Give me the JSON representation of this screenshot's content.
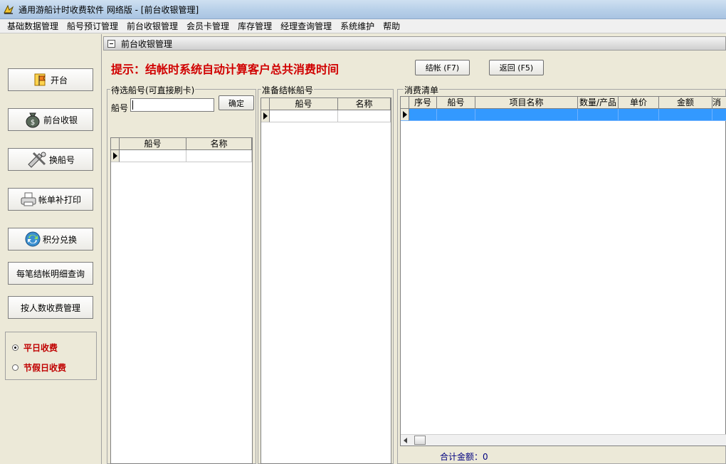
{
  "window": {
    "title": "通用游船计时收费软件  网络版 - [前台收银管理]"
  },
  "menu": [
    "基础数据管理",
    "船号预订管理",
    "前台收银管理",
    "会员卡管理",
    "库存管理",
    "经理查询管理",
    "系统维护",
    "帮助"
  ],
  "left": {
    "buttons": [
      {
        "label": "开台",
        "icon": "flag-icon"
      },
      {
        "label": "前台收银",
        "icon": "money-bag-icon"
      },
      {
        "label": "换船号",
        "icon": "tools-icon"
      },
      {
        "label": "帐单补打印",
        "icon": "printer-icon"
      },
      {
        "label": "积分兑换",
        "icon": "exchange-icon"
      },
      {
        "label": "每笔结帐明细查询"
      },
      {
        "label": "按人数收费管理"
      }
    ],
    "radios": [
      {
        "label": "平日收费",
        "checked": true
      },
      {
        "label": "节假日收费",
        "checked": false
      }
    ]
  },
  "main": {
    "header": "前台收银管理",
    "hint": "提示：结帐时系统自动计算客户总共消费时间",
    "checkout_button": "结帐 (F7)",
    "back_button": "返回 (F5)",
    "pending": {
      "title": "待选船号(可直接刷卡)",
      "boat_label": "船号",
      "confirm_button": "确定",
      "columns": [
        "船号",
        "名称"
      ]
    },
    "ready": {
      "title": "准备结帐船号",
      "columns": [
        "船号",
        "名称"
      ]
    },
    "consume": {
      "title": "消费清单",
      "columns": [
        "序号",
        "船号",
        "项目名称",
        "数量/产品",
        "单价",
        "金额",
        "消"
      ]
    },
    "total": "合计金额：0"
  }
}
